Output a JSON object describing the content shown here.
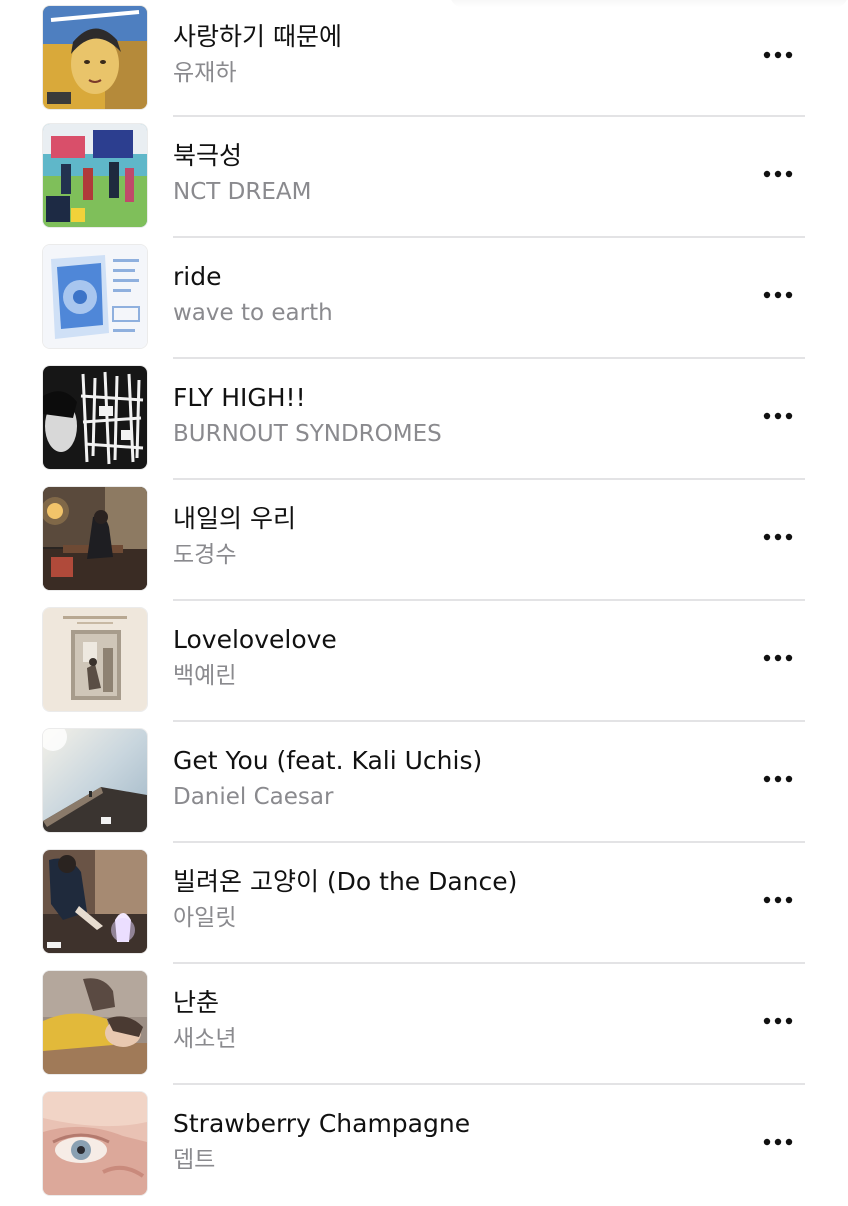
{
  "tracks": [
    {
      "title": "사랑하기 때문에",
      "artist": "유재하",
      "artwork": "album-artwork"
    },
    {
      "title": "북극성",
      "artist": "NCT DREAM",
      "artwork": "album-artwork"
    },
    {
      "title": "ride",
      "artist": "wave to earth",
      "artwork": "album-artwork"
    },
    {
      "title": "FLY HIGH!!",
      "artist": "BURNOUT SYNDROMES",
      "artwork": "album-artwork"
    },
    {
      "title": "내일의 우리",
      "artist": "도경수",
      "artwork": "album-artwork"
    },
    {
      "title": "Lovelovelove",
      "artist": "백예린",
      "artwork": "album-artwork"
    },
    {
      "title": "Get You (feat. Kali Uchis)",
      "artist": "Daniel Caesar",
      "artwork": "album-artwork"
    },
    {
      "title": "빌려온 고양이 (Do the Dance)",
      "artist": "아일릿",
      "artwork": "album-artwork"
    },
    {
      "title": "난춘",
      "artist": "새소년",
      "artwork": "album-artwork"
    },
    {
      "title": "Strawberry Champagne",
      "artist": "뎁트",
      "artwork": "album-artwork"
    }
  ],
  "icons": {
    "more": "more-options-icon"
  },
  "colors": {
    "title_text": "#111111",
    "artist_text": "#8a8a8e",
    "divider": "#e3e3e5",
    "background": "#ffffff"
  }
}
